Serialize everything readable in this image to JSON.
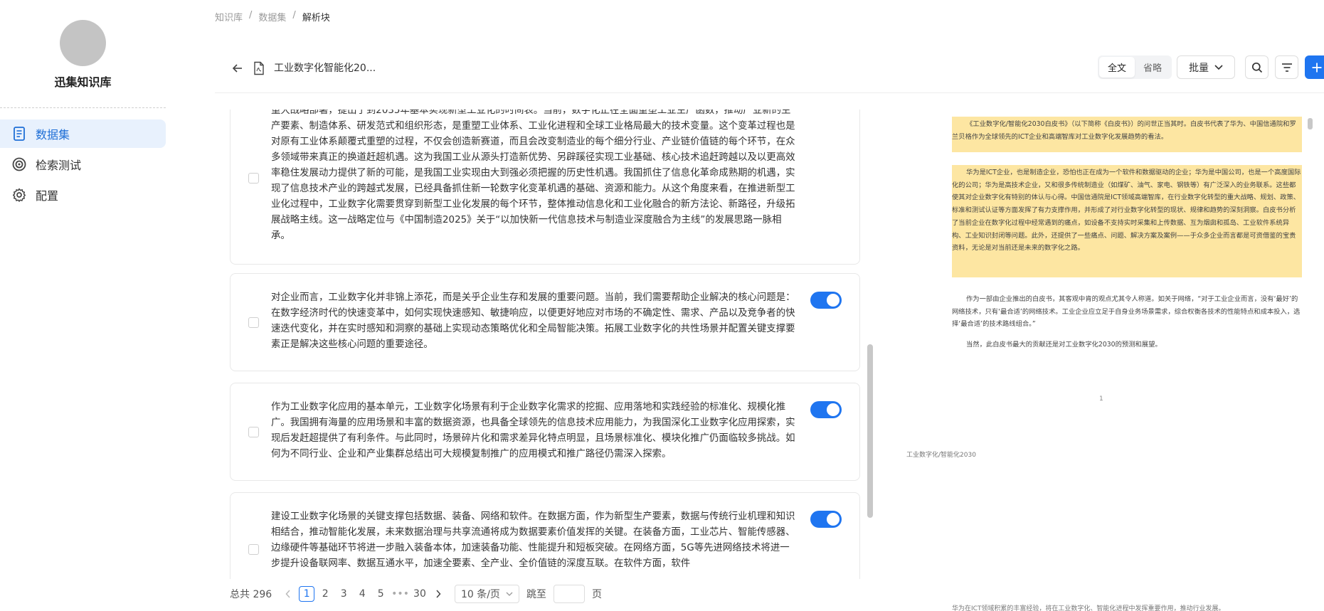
{
  "app": {
    "name": "迅集知识库"
  },
  "sidebar": {
    "items": [
      {
        "label": "数据集",
        "icon": "document-icon",
        "active": true
      },
      {
        "label": "检索测试",
        "icon": "target-icon",
        "active": false
      },
      {
        "label": "配置",
        "icon": "gear-icon",
        "active": false
      }
    ]
  },
  "breadcrumb": {
    "items": [
      "知识库",
      "数据集",
      "解析块"
    ],
    "separator": "/"
  },
  "header": {
    "doc_title": "工业数字化智能化20...",
    "view_full": "全文",
    "view_brief": "省略",
    "batch_label": "批量",
    "icons": [
      "search-icon",
      "filter-icon",
      "plus-icon"
    ]
  },
  "chunks": [
    {
      "text": "重大战略部署，提出了到2035年基本实现新型工业化的时间表。当前，数字化正在全面重塑工业生产函数，推动产业新的生产要素、制造体系、研发范式和组织形态，是重塑工业体系、工业化进程和全球工业格局最大的技术变量。这个变革过程也是对原有工业体系颠覆式重塑的过程，不仅会创造新赛道，而且会改变制造业的每个细分行业、产业链价值链的每个环节，在众多领域带来真正的换道赶超机遇。这为我国工业从源头打造新优势、另辟蹊径实现工业基础、核心技术追赶跨越以及以更高效率稳住发展动力提供了新的可能，是我国工业实现由大到强必须把握的历史性机遇。我国抓住了信息化革命成熟期的机遇，实现了信息技术产业的跨越式发展，已经具备抓住新一轮数字化变革机遇的基础、资源和能力。从这个角度来看，在推进新型工业化过程中，工业数字化需要贯穿到新型工业化发展的每个环节，整体推动信息化和工业化融合的新方法论、新路径，升级拓展战略主线。这一战略定位与《中国制造2025》关于“以加快新一代信息技术与制造业深度融合为主线”的发展思路一脉相承。",
      "enabled": null
    },
    {
      "text": "对企业而言，工业数字化并非锦上添花，而是关乎企业生存和发展的重要问题。当前，我们需要帮助企业解决的核心问题是：在数字经济时代的快速变革中，如何实现快速感知、敏捷响应，以便更好地应对市场的不确定性、需求、产品以及竞争者的快速迭代变化，并在实时感知和洞察的基础上实现动态策略优化和全局智能决策。拓展工业数字化的共性场景并配置关键支撑要素正是解决这些核心问题的重要途径。",
      "enabled": true
    },
    {
      "text": "作为工业数字化应用的基本单元，工业数字化场景有利于企业数字化需求的挖掘、应用落地和实践经验的标准化、规模化推广。我国拥有海量的应用场景和丰富的数据资源，也具备全球领先的信息技术应用能力，为我国深化工业数字化应用探索，实现后发赶超提供了有利条件。与此同时，场景碎片化和需求差异化特点明显，且场景标准化、模块化推广仍面临较多挑战。如何为不同行业、企业和产业集群总结出可大规模复制推广的应用模式和推广路径仍需深入探索。",
      "enabled": true
    },
    {
      "text": "建设工业数字化场景的关键支撑包括数据、装备、网络和软件。在数据方面，作为新型生产要素，数据与传统行业机理和知识相结合，推动智能化发展，未来数据治理与共享流通将成为数据要素价值发挥的关键。在装备方面，工业芯片、智能传感器、边缘硬件等基础环节将进一步融入装备本体，加速装备功能、性能提升和短板突破。在网络方面，5G等先进网络技术将进一步提升设备联网率、数据互通水平，加速全要素、全产业、全价值链的深度互联。在软件方面，软件",
      "enabled": true
    }
  ],
  "pagination": {
    "total_label": "总共 296",
    "pages": [
      "1",
      "2",
      "3",
      "4",
      "5",
      "•••",
      "30"
    ],
    "current": "1",
    "page_size_label": "10 条/页",
    "jump_label": "跳至",
    "page_unit": "页"
  },
  "preview": {
    "highlight_1": "《工业数字化/智能化2030白皮书》（以下简称《白皮书》）的问世正当其时。白皮书代表了华为、中国信通院和罗兰贝格作为全球领先的ICT企业和高端智库对工业数字化发展趋势的看法。",
    "highlight_2": "华为是ICT企业，也是制造企业，恐怕也正在成为一个软件和数据驱动的企业；华为是中国公司，也是一个高度国际化的公司；华为是高技术企业，又和很多传统制造业（如煤矿、油气、家电、钢铁等）有广泛深入的业务联系。这些都使其对企业数字化有特别的体认与心得。中国信通院是ICT领域高端智库，在行业数字化转型的重大战略、规划、政策、标准和测试认证等方面发挥了有力支撑作用，并形成了对行业数字化转型的现状、规律和趋势的深刻洞察。白皮书分析了当前企业在数字化过程中经常遇到的痛点，如设备不支持实时采集和上传数据、互为烟囱和孤岛、工业软件系统异构、工业知识封闭等问题。此外，还提供了一些痛点、问题、解决方案及案例——于众多企业而言都是可资借鉴的宝贵资料，无论是对当前还是未来的数字化之路。",
    "para_1": "作为一部由企业推出的白皮书，其客观中肯的观点尤其令人称道。如关于网络，“对于工业企业而言，没有‘最好’的网络技术，只有‘最合适’的网络技术。工业企业应立足于自身业务场景需求，综合权衡各技术的性能特点和成本投入，选择‘最合适’的技术路线组合。”",
    "para_2": "当然，此白皮书最大的贡献还是对工业数字化2030的预测和展望。",
    "page_number": "1",
    "footer": "工业数字化/智能化2030",
    "bottom_fragment": "华为在ICT领域积累的丰富经验，将在工业数字化、智能化进程中发挥重要作用，推动行业发展。"
  },
  "colors": {
    "accent": "#1f75f0",
    "highlight": "#fde6a2",
    "active_bg": "#e8f1fd"
  }
}
